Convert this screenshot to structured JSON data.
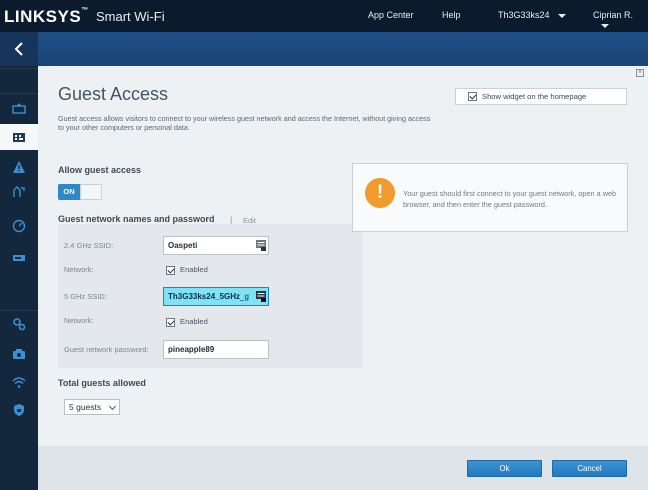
{
  "brand": {
    "logo": "LINKSYS",
    "tm": "™",
    "product": "Smart Wi-Fi"
  },
  "topnav": {
    "app_center": "App Center",
    "help": "Help",
    "network": "Th3G33ks24",
    "user": "Ciprian R."
  },
  "page": {
    "title": "Guest Access",
    "description": "Guest access allows visitors to connect to your wireless guest network and access the Internet, without giving access to your other computers or personal data.",
    "widget_checkbox": {
      "label": "Show widget on the homepage",
      "checked": true
    }
  },
  "guest_access": {
    "heading": "Allow guest access",
    "toggle_label": "ON",
    "enabled": true
  },
  "networks": {
    "heading": "Guest network names and password",
    "separator": "|",
    "edit_label": "Edit",
    "ssid_24_label": "2.4 GHz SSID:",
    "ssid_24_value": "Oaspeti",
    "network_label": "Network:",
    "enabled_label": "Enabled",
    "ssid_5_label": "5 GHz SSID:",
    "ssid_5_value": "Th3G33ks24_5GHz",
    "ssid_5_suffix": "_g",
    "password_label": "Guest network password:",
    "password_value": "pineapple89"
  },
  "notice": {
    "icon": "!",
    "text": "Your guest should first connect to your guest network, open a web browser, and then enter the guest password."
  },
  "total_guests": {
    "heading": "Total guests allowed",
    "selected": "5 guests"
  },
  "buttons": {
    "ok": "Ok",
    "cancel": "Cancel"
  },
  "colors": {
    "accent": "#2f86c9",
    "topbar": "#0b1b2d",
    "warning": "#f29a2e"
  }
}
